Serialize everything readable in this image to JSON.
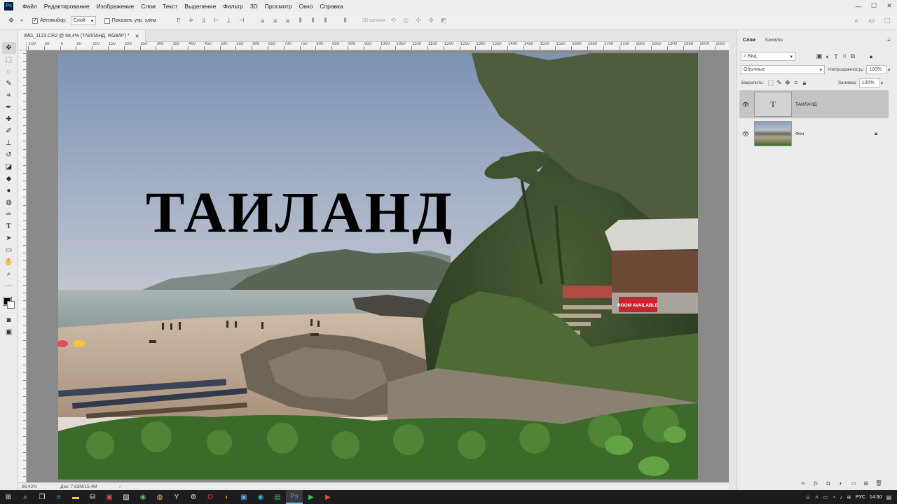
{
  "app": {
    "logo": "Ps"
  },
  "menu": [
    "Файл",
    "Редактирование",
    "Изображение",
    "Слои",
    "Текст",
    "Выделение",
    "Фильтр",
    "3D",
    "Просмотр",
    "Окно",
    "Справка"
  ],
  "window_controls": {
    "minimize": "—",
    "maximize": "☐",
    "close": "✕"
  },
  "options": {
    "autoselect_label": "Автовыбор:",
    "autoselect_target": "Слой",
    "show_controls_label": "Показать упр. элем",
    "mode_3d_label": "3D-режим"
  },
  "document": {
    "tab_title": "IMG_1123.CR2 @ 68,4% (ТАИЛАНД, RGB/8*) *",
    "close": "✕",
    "canvas_text": "ТАИЛАНД"
  },
  "ruler_h_labels": [
    "100",
    "50",
    "0",
    "50",
    "100",
    "150",
    "200",
    "250",
    "300",
    "350",
    "400",
    "450",
    "500",
    "550",
    "600",
    "650",
    "700",
    "750",
    "800",
    "850",
    "900",
    "950",
    "1000",
    "1050",
    "1100",
    "1150",
    "1200",
    "1250",
    "1300",
    "1350",
    "1400",
    "1450",
    "1500",
    "1550",
    "1600",
    "1650",
    "1700",
    "1750",
    "1800",
    "1850",
    "1900",
    "1950",
    "2000",
    "2050"
  ],
  "status": {
    "zoom": "68,42%",
    "doc_info": "Док: 7,63M/15,4M"
  },
  "panel": {
    "tabs": [
      "Слои",
      "Каналы"
    ],
    "filter_kind": "Вид",
    "blend_mode": "Обычные",
    "opacity_label": "Непрозрачность:",
    "opacity_value": "100%",
    "lock_label": "Закрепить:",
    "fill_label": "Заливка:",
    "fill_value": "100%",
    "layers": [
      {
        "name": "ТАИЛАНД",
        "thumb": "T",
        "selected": true
      },
      {
        "name": "Фон",
        "thumb": "",
        "locked": true
      }
    ]
  },
  "photo": {
    "sign_text": "ROOM AVAILABLE"
  },
  "taskbar": {
    "lang": "РУС",
    "time": "14:50"
  },
  "colors": {
    "accent": "#31a8ff",
    "selected_layer": "#c4c4c4",
    "taskbar": "#1d1d1f"
  }
}
